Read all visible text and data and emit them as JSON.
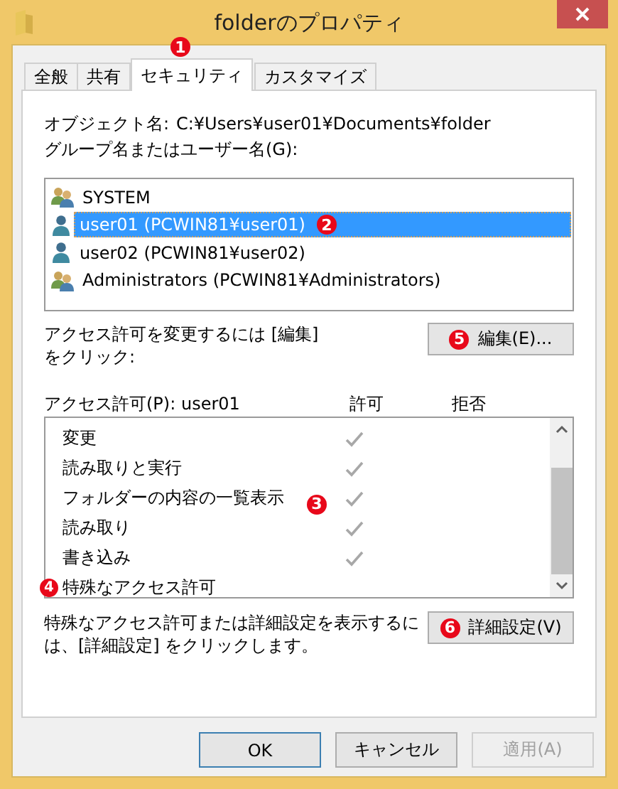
{
  "window": {
    "title": "folderのプロパティ"
  },
  "tabs": [
    {
      "label": "全般",
      "selected": false
    },
    {
      "label": "共有",
      "selected": false
    },
    {
      "label": "セキュリティ",
      "selected": true,
      "marker": "1"
    },
    {
      "label": "カスタマイズ",
      "selected": false
    }
  ],
  "object_name": {
    "label": "オブジェクト名:",
    "value": "C:¥Users¥user01¥Documents¥folder"
  },
  "users_label": "グループ名またはユーザー名(G):",
  "users": [
    {
      "name": "SYSTEM",
      "kind": "group",
      "selected": false
    },
    {
      "name": "user01 (PCWIN81¥user01)",
      "kind": "user",
      "selected": true,
      "marker": "2"
    },
    {
      "name": "user02 (PCWIN81¥user02)",
      "kind": "user",
      "selected": false
    },
    {
      "name": "Administrators (PCWIN81¥Administrators)",
      "kind": "group",
      "selected": false
    }
  ],
  "edit_hint": [
    "アクセス許可を変更するには [編集]",
    "をクリック:"
  ],
  "edit_button": {
    "label": "編集(E)...",
    "marker": "5"
  },
  "permissions": {
    "label": "アクセス許可(P): user01",
    "columns": [
      "許可",
      "拒否"
    ],
    "marker": "3",
    "rows": [
      {
        "name": "変更",
        "allow": true
      },
      {
        "name": "読み取りと実行",
        "allow": true
      },
      {
        "name": "フォルダーの内容の一覧表示",
        "allow": true
      },
      {
        "name": "読み取り",
        "allow": true
      },
      {
        "name": "書き込み",
        "allow": true
      },
      {
        "name": "特殊なアクセス許可",
        "allow": false,
        "marker": "4"
      }
    ]
  },
  "advanced_hint": [
    "特殊なアクセス許可または詳細設定を表示するに",
    "は、[詳細設定] をクリックします。"
  ],
  "advanced_button": {
    "label": "詳細設定(V)",
    "marker": "6"
  },
  "buttons": [
    {
      "label": "OK",
      "kind": "default",
      "disabled": false
    },
    {
      "label": "キャンセル",
      "kind": "normal",
      "disabled": false
    },
    {
      "label": "適用(A)",
      "kind": "normal",
      "disabled": true
    }
  ]
}
